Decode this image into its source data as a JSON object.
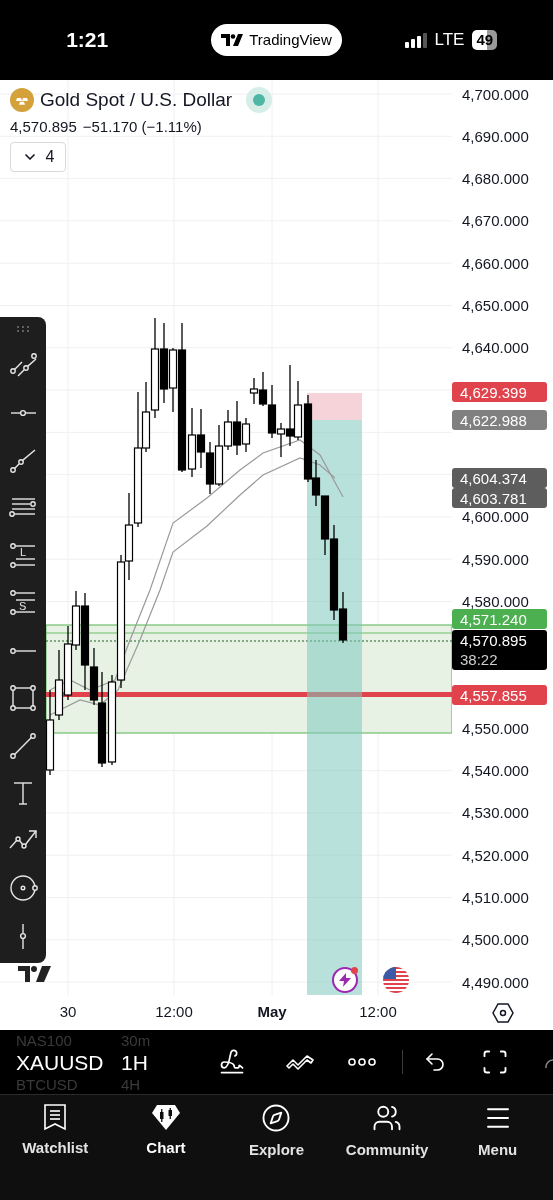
{
  "status_bar": {
    "time": "1:21",
    "app_pill": "TradingView",
    "network": "LTE",
    "battery": "49"
  },
  "symbol_header": {
    "title": "Gold Spot / U.S. Dollar",
    "market_open": true,
    "price": "4,570.895",
    "change": "−51.170 (−1.11%)",
    "collapse_count": "4"
  },
  "toolbar_letters": [
    "L",
    "S"
  ],
  "price_axis": {
    "ticks": [
      "4,700.000",
      "4,690.000",
      "4,680.000",
      "4,670.000",
      "4,660.000",
      "4,650.000",
      "4,640.000",
      "4,600.000",
      "4,590.000",
      "4,580.000",
      "4,550.000",
      "4,540.000",
      "4,530.000",
      "4,520.000",
      "4,510.000",
      "4,500.000",
      "4,490.000"
    ]
  },
  "price_tags": [
    {
      "price": "4,629.399",
      "color": "#e0434c"
    },
    {
      "price": "4,622.988",
      "color": "#808080"
    },
    {
      "price": "4,604.374",
      "color": "#5d5d5d"
    },
    {
      "price": "4,603.781",
      "color": "#5d5d5d"
    },
    {
      "price": "4,571.240",
      "color": "#4caf50"
    },
    {
      "price": "4,570.895",
      "countdown": "38:22",
      "color": "#000000"
    },
    {
      "price": "4,557.855",
      "color": "#e0434c"
    }
  ],
  "time_axis": [
    {
      "text": "30",
      "kind": "day"
    },
    {
      "text": "12:00",
      "kind": "time"
    },
    {
      "text": "May",
      "kind": "month"
    },
    {
      "text": "12:00",
      "kind": "time"
    }
  ],
  "symbol_picker": [
    {
      "symbol": "NAS100",
      "interval": "30m",
      "selected": false
    },
    {
      "symbol": "XAUUSD",
      "interval": "1H",
      "selected": true
    },
    {
      "symbol": "BTCUSD",
      "interval": "4H",
      "selected": false
    }
  ],
  "tab_bar": [
    {
      "label": "Watchlist",
      "kind": "watchlist",
      "selected": false
    },
    {
      "label": "Chart",
      "kind": "chart",
      "selected": true
    },
    {
      "label": "Explore",
      "kind": "explore",
      "selected": false
    },
    {
      "label": "Community",
      "kind": "community",
      "selected": false
    },
    {
      "label": "Menu",
      "kind": "menu",
      "selected": false
    }
  ]
}
